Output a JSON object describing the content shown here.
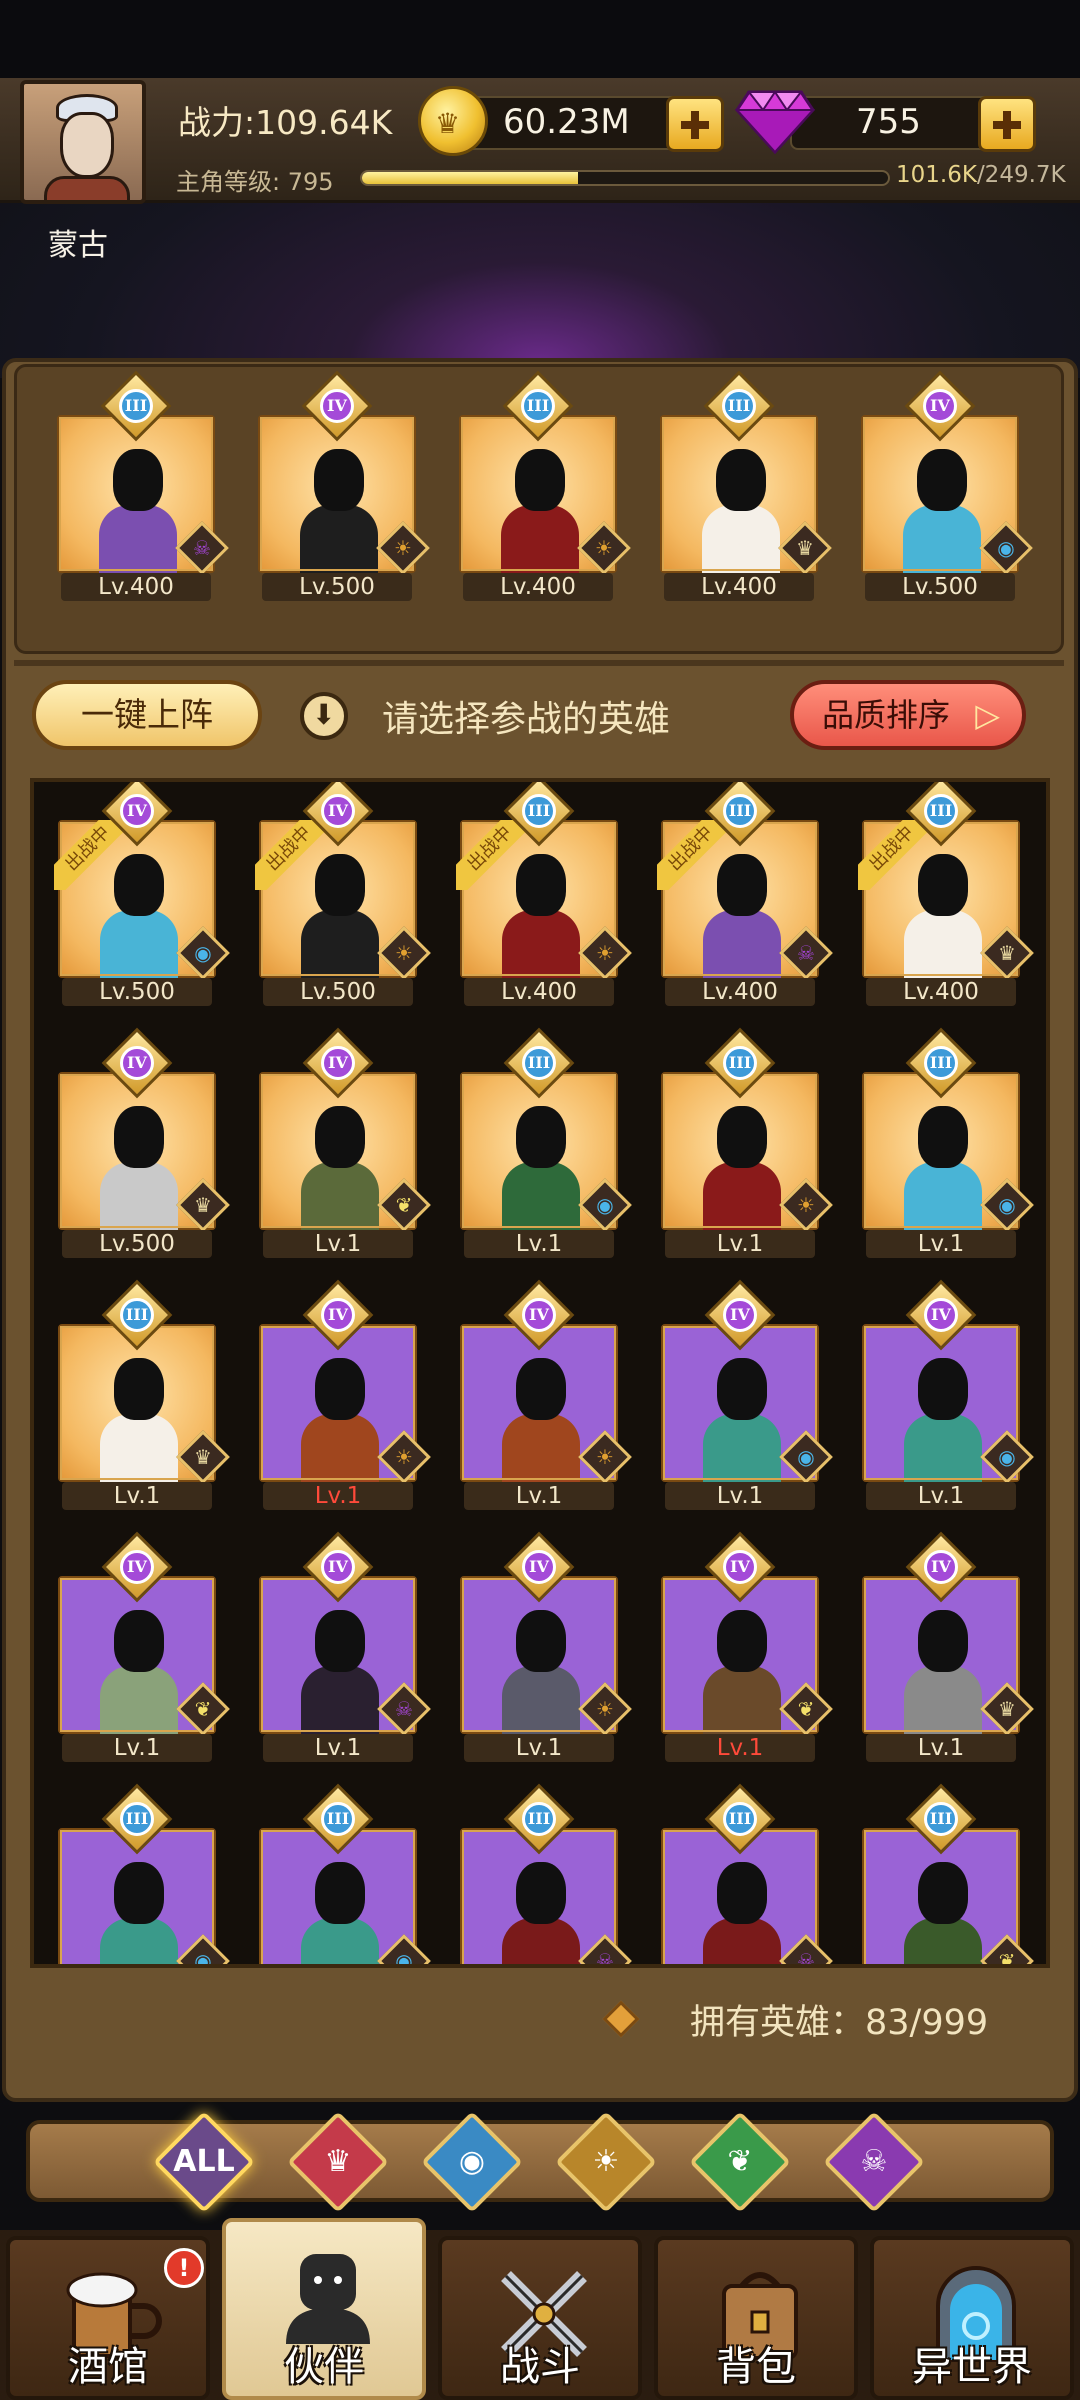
{
  "player": {
    "name": "蒙古",
    "power": "战力:109.64K",
    "level_label": "主角等级: 795",
    "exp_current": "101.6K",
    "exp_max": "/249.7K",
    "exp_fraction": 0.41
  },
  "currency": {
    "coins": "60.23M",
    "gems": "755"
  },
  "lineup": [
    {
      "rank": "III",
      "level": "Lv.400",
      "bg": "gold",
      "faction": "demon",
      "skin": "#7b4fb0"
    },
    {
      "rank": "IV",
      "level": "Lv.500",
      "bg": "gold",
      "faction": "beast",
      "skin": "#1e1e1e"
    },
    {
      "rank": "III",
      "level": "Lv.400",
      "bg": "gold",
      "faction": "beast",
      "skin": "#8a1a1a"
    },
    {
      "rank": "III",
      "level": "Lv.400",
      "bg": "gold",
      "faction": "human",
      "skin": "#f5f0e8"
    },
    {
      "rank": "IV",
      "level": "Lv.500",
      "bg": "gold",
      "faction": "fishfolk",
      "skin": "#49b4d6"
    }
  ],
  "controls": {
    "one_key_deploy": "一键上阵",
    "hint": "请选择参战的英雄",
    "sort_label": "品质排序",
    "sort_arrow": "▷"
  },
  "deployed_tag": "出战中",
  "heroes": [
    {
      "rank": "IV",
      "level": "Lv.500",
      "bg": "gold",
      "faction": "fishfolk",
      "deployed": true,
      "skin": "#49b4d6"
    },
    {
      "rank": "IV",
      "level": "Lv.500",
      "bg": "gold",
      "faction": "beast",
      "deployed": true,
      "skin": "#1e1e1e"
    },
    {
      "rank": "III",
      "level": "Lv.400",
      "bg": "gold",
      "faction": "beast",
      "deployed": true,
      "skin": "#8a1a1a"
    },
    {
      "rank": "III",
      "level": "Lv.400",
      "bg": "gold",
      "faction": "demon",
      "deployed": true,
      "skin": "#7b4fb0"
    },
    {
      "rank": "III",
      "level": "Lv.400",
      "bg": "gold",
      "faction": "human",
      "deployed": true,
      "skin": "#f5f0e8"
    },
    {
      "rank": "IV",
      "level": "Lv.500",
      "bg": "gold",
      "faction": "human",
      "deployed": false,
      "skin": "#c9c9c9"
    },
    {
      "rank": "IV",
      "level": "Lv.1",
      "bg": "gold",
      "faction": "elf",
      "deployed": false,
      "skin": "#5b6a3a"
    },
    {
      "rank": "III",
      "level": "Lv.1",
      "bg": "gold",
      "faction": "fishfolk",
      "deployed": false,
      "skin": "#2e6a3a"
    },
    {
      "rank": "III",
      "level": "Lv.1",
      "bg": "gold",
      "faction": "beast",
      "deployed": false,
      "skin": "#8a1a1a"
    },
    {
      "rank": "III",
      "level": "Lv.1",
      "bg": "gold",
      "faction": "fishfolk",
      "deployed": false,
      "skin": "#49b4d6"
    },
    {
      "rank": "III",
      "level": "Lv.1",
      "bg": "gold",
      "faction": "human",
      "deployed": false,
      "skin": "#f5f0e8"
    },
    {
      "rank": "IV",
      "level": "Lv.1",
      "bg": "purple",
      "faction": "beast",
      "deployed": false,
      "level_red": true,
      "skin": "#a0461e"
    },
    {
      "rank": "IV",
      "level": "Lv.1",
      "bg": "purple",
      "faction": "beast",
      "deployed": false,
      "skin": "#a0461e"
    },
    {
      "rank": "IV",
      "level": "Lv.1",
      "bg": "purple",
      "faction": "fishfolk",
      "deployed": false,
      "skin": "#3a9a8a"
    },
    {
      "rank": "IV",
      "level": "Lv.1",
      "bg": "purple",
      "faction": "fishfolk",
      "deployed": false,
      "skin": "#3a9a8a"
    },
    {
      "rank": "IV",
      "level": "Lv.1",
      "bg": "purple",
      "faction": "elf",
      "deployed": false,
      "skin": "#8aa27a"
    },
    {
      "rank": "IV",
      "level": "Lv.1",
      "bg": "purple",
      "faction": "demon",
      "deployed": false,
      "skin": "#2a2030"
    },
    {
      "rank": "IV",
      "level": "Lv.1",
      "bg": "purple",
      "faction": "beast",
      "deployed": false,
      "skin": "#5a5a6a"
    },
    {
      "rank": "IV",
      "level": "Lv.1",
      "bg": "purple",
      "faction": "elf",
      "deployed": false,
      "level_red": true,
      "skin": "#6a4a2a"
    },
    {
      "rank": "IV",
      "level": "Lv.1",
      "bg": "purple",
      "faction": "human",
      "deployed": false,
      "skin": "#8a8a8a"
    },
    {
      "rank": "III",
      "level": "",
      "bg": "purple",
      "faction": "fishfolk",
      "deployed": false,
      "skin": "#3a9a8a"
    },
    {
      "rank": "III",
      "level": "",
      "bg": "purple",
      "faction": "fishfolk",
      "deployed": false,
      "skin": "#3a9a8a"
    },
    {
      "rank": "III",
      "level": "",
      "bg": "purple",
      "faction": "demon",
      "deployed": false,
      "skin": "#7a1a1a"
    },
    {
      "rank": "III",
      "level": "",
      "bg": "purple",
      "faction": "demon",
      "deployed": false,
      "skin": "#7a1a1a"
    },
    {
      "rank": "III",
      "level": "",
      "bg": "purple",
      "faction": "elf",
      "deployed": false,
      "skin": "#3a5a2a"
    }
  ],
  "owned": "拥有英雄：83/999",
  "filters": [
    {
      "id": "all",
      "label": "ALL",
      "color": "#6a4a8a",
      "active": true
    },
    {
      "id": "human",
      "label": "",
      "color": "#c43a4a",
      "glyph": "♛"
    },
    {
      "id": "fishfolk",
      "label": "",
      "color": "#3a8ac4",
      "glyph": "◉"
    },
    {
      "id": "beast",
      "label": "",
      "color": "#b8862a",
      "glyph": "☀"
    },
    {
      "id": "elf",
      "label": "",
      "color": "#3a9a4a",
      "glyph": "❦"
    },
    {
      "id": "demon",
      "label": "",
      "color": "#8a3ab0",
      "glyph": "☠"
    }
  ],
  "nav": [
    {
      "id": "tavern",
      "label": "酒馆",
      "alert": "!"
    },
    {
      "id": "partner",
      "label": "伙伴",
      "active": true
    },
    {
      "id": "battle",
      "label": "战斗"
    },
    {
      "id": "bag",
      "label": "背包"
    },
    {
      "id": "otherworld",
      "label": "异世界"
    }
  ],
  "faction_glyphs": {
    "demon": "☠",
    "beast": "☀",
    "human": "♛",
    "fishfolk": "◉",
    "elf": "❦"
  },
  "faction_colors": {
    "demon": "#a044d0",
    "beast": "#e0a030",
    "human": "#e8d8a0",
    "fishfolk": "#4ab4e8",
    "elf": "#f4e06a"
  }
}
